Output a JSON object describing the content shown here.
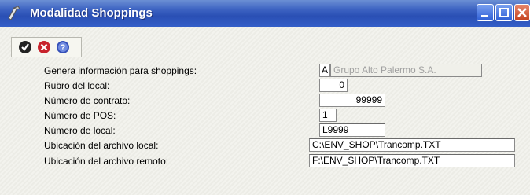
{
  "window": {
    "title": "Modalidad Shoppings"
  },
  "toolbar": {
    "icons": [
      "check-icon",
      "cancel-icon",
      "help-icon"
    ]
  },
  "form": {
    "genera": {
      "label": "Genera información para shoppings:",
      "code": "A",
      "name": "Grupo Alto Palermo S.A."
    },
    "rubro": {
      "label": "Rubro del local:",
      "value": "0"
    },
    "contrato": {
      "label": "Número de contrato:",
      "value": "99999"
    },
    "pos": {
      "label": "Número de POS:",
      "value": "1"
    },
    "local": {
      "label": "Número de local:",
      "value": "L9999"
    },
    "archivo_local": {
      "label": "Ubicación del archivo local:",
      "value": "C:\\ENV_SHOP\\Trancomp.TXT"
    },
    "archivo_remoto": {
      "label": "Ubicación del archivo remoto:",
      "value": "F:\\ENV_SHOP\\Trancomp.TXT"
    }
  },
  "colors": {
    "titlebar": "#2a4fb4",
    "close": "#c4421f"
  }
}
